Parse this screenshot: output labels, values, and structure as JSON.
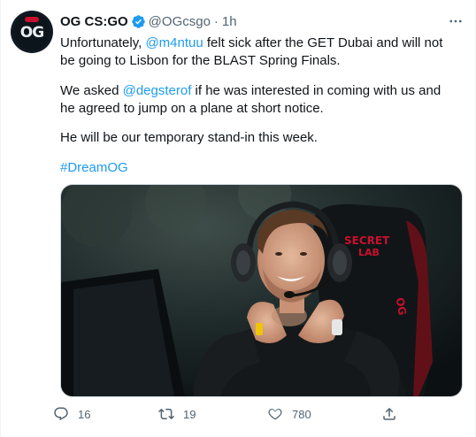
{
  "author": {
    "name": "OG CS:GO",
    "handle": "@OGcsgo",
    "separator": "·",
    "time": "1h",
    "avatar_text": "OG",
    "verified": true
  },
  "tweet": {
    "p1_a": "Unfortunately, ",
    "p1_mention": "@m4ntuu",
    "p1_b": " felt sick after the GET Dubai and will not be going to Lisbon for the BLAST Spring Finals.",
    "p2_a": "We asked ",
    "p2_mention": "@degsterof",
    "p2_b": " if he was interested in coming with us and he agreed to jump on a plane at short notice.",
    "p3": "He will be our temporary stand-in this week.",
    "hashtag": "#DreamOG"
  },
  "media": {
    "chair_text_line1": "SECRET",
    "chair_text_line2": "LAB",
    "chair_side_text": "OG"
  },
  "actions": {
    "replies": "16",
    "retweets": "19",
    "likes": "780"
  },
  "colors": {
    "link": "#1d9bf0",
    "text": "#0f1419",
    "secondary": "#536471",
    "chair_red": "#c8102e"
  },
  "icons": [
    "more-icon",
    "verified-icon",
    "reply-icon",
    "retweet-icon",
    "like-icon",
    "share-icon"
  ]
}
